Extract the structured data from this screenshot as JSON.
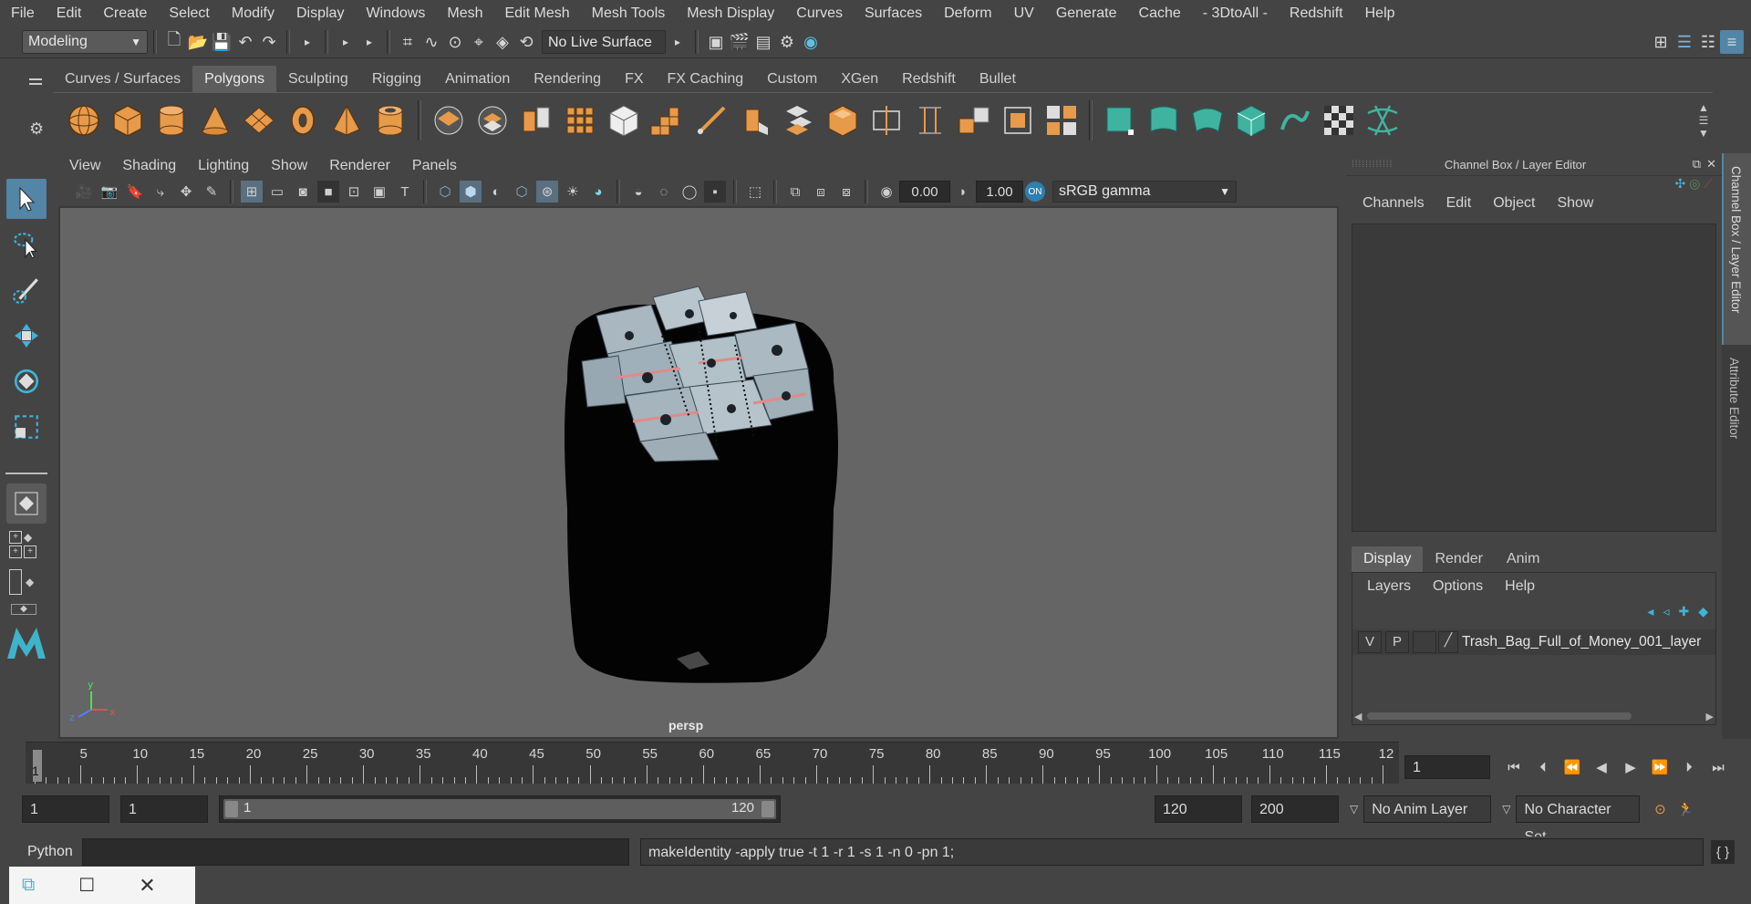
{
  "menubar": [
    "File",
    "Edit",
    "Create",
    "Select",
    "Modify",
    "Display",
    "Windows",
    "Mesh",
    "Edit Mesh",
    "Mesh Tools",
    "Mesh Display",
    "Curves",
    "Surfaces",
    "Deform",
    "UV",
    "Generate",
    "Cache",
    "- 3DtoAll -",
    "Redshift",
    "Help"
  ],
  "statusline": {
    "workspace": "Modeling",
    "live_surface": "No Live Surface"
  },
  "shelf_tabs": [
    "Curves / Surfaces",
    "Polygons",
    "Sculpting",
    "Rigging",
    "Animation",
    "Rendering",
    "FX",
    "FX Caching",
    "Custom",
    "XGen",
    "Redshift",
    "Bullet"
  ],
  "shelf_active": "Polygons",
  "viewport_menus": [
    "View",
    "Shading",
    "Lighting",
    "Show",
    "Renderer",
    "Panels"
  ],
  "viewport": {
    "near_value": "0.00",
    "gamma_value": "1.00",
    "color_space": "sRGB gamma",
    "camera_label": "persp"
  },
  "channel_box": {
    "title": "Channel Box / Layer Editor",
    "menus": [
      "Channels",
      "Edit",
      "Object",
      "Show"
    ]
  },
  "layer_editor": {
    "tabs": [
      "Display",
      "Render",
      "Anim"
    ],
    "active_tab": "Display",
    "menus": [
      "Layers",
      "Options",
      "Help"
    ],
    "layer": {
      "v": "V",
      "p": "P",
      "name": "Trash_Bag_Full_of_Money_001_layer"
    }
  },
  "side_tabs": [
    "Channel Box / Layer Editor",
    "Attribute Editor"
  ],
  "timeline": {
    "ticks": [
      "5",
      "10",
      "15",
      "20",
      "25",
      "30",
      "35",
      "40",
      "45",
      "50",
      "55",
      "60",
      "65",
      "70",
      "75",
      "80",
      "85",
      "90",
      "95",
      "100",
      "105",
      "110",
      "115",
      "12"
    ],
    "current_frame_marker": "1",
    "current_frame": "1"
  },
  "range": {
    "start": "1",
    "playback_start": "1",
    "slider_start": "1",
    "slider_end": "120",
    "playback_end": "120",
    "end": "200",
    "anim_layer": "No Anim Layer",
    "character_set": "No Character Set"
  },
  "command": {
    "language": "Python",
    "output": "makeIdentity -apply true -t 1 -r 1 -s 1 -n 0 -pn 1;"
  },
  "colors": {
    "accent": "#5285a6",
    "shelf_orange": "#e69a4a",
    "shelf_teal": "#3fb3a0",
    "bg": "#444444",
    "viewport": "#656565"
  }
}
